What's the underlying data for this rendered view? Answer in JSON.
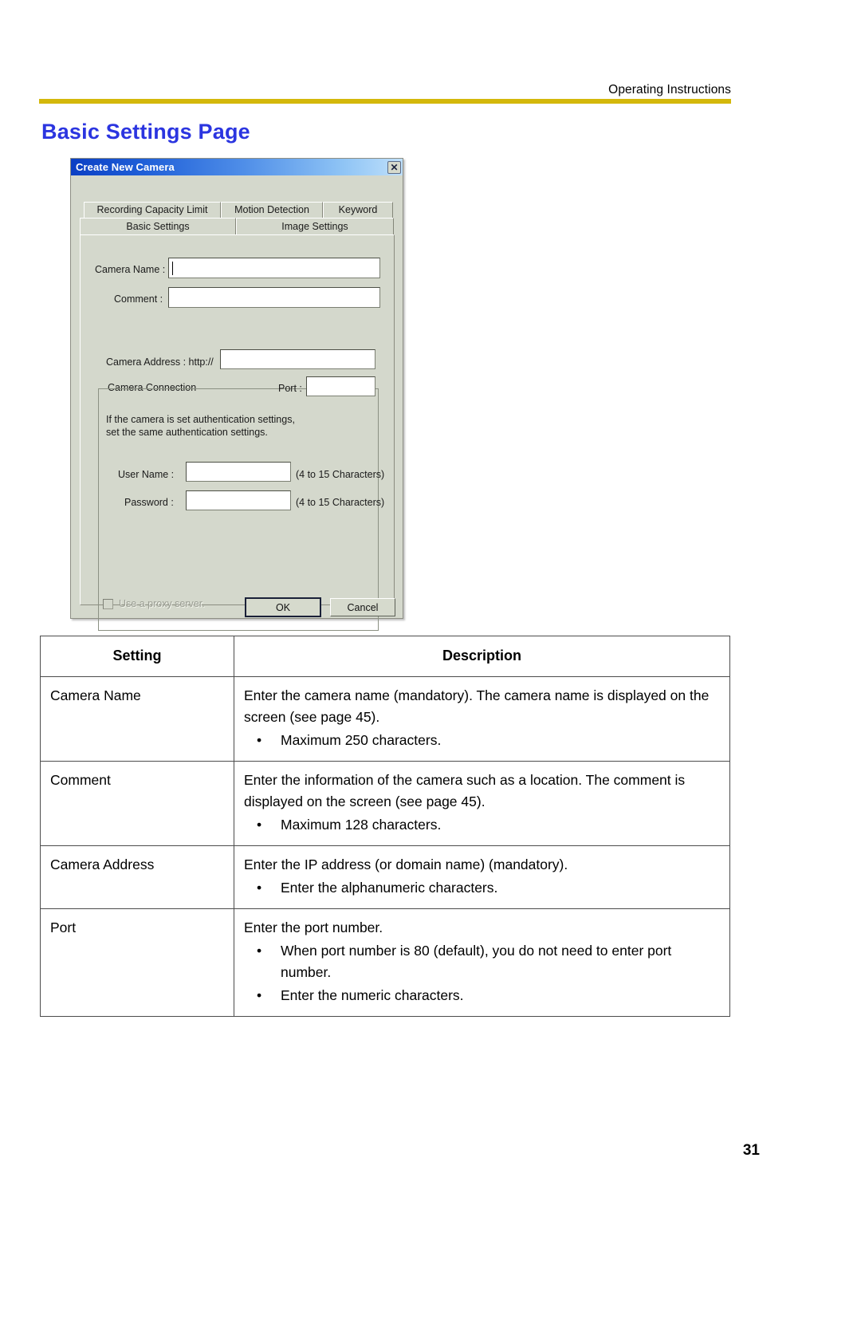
{
  "header": {
    "running_head": "Operating Instructions",
    "title": "Basic Settings Page",
    "rule_color": "#d4b80b",
    "title_color": "#2b35e0"
  },
  "dialog": {
    "title": "Create New Camera",
    "close_icon": "close-icon",
    "close_glyph": "✕",
    "tabs_top": [
      {
        "label": "Recording Capacity Limit"
      },
      {
        "label": "Motion Detection"
      },
      {
        "label": "Keyword"
      }
    ],
    "tabs_bottom": [
      {
        "label": "Basic Settings",
        "selected": true
      },
      {
        "label": "Image Settings",
        "selected": false
      }
    ],
    "fields": {
      "camera_name_label": "Camera Name :",
      "camera_name_value": "",
      "comment_label": "Comment :",
      "comment_value": ""
    },
    "group": {
      "title": "Camera Connection",
      "camera_address_label": "Camera Address : http://",
      "camera_address_value": "",
      "port_label": "Port :",
      "port_value": "",
      "auth_note": "If the camera is set authentication settings,\nset the same authentication settings.",
      "user_name_label": "User Name :",
      "user_name_value": "",
      "user_name_hint": "(4 to 15 Characters)",
      "password_label": "Password :",
      "password_value": "",
      "password_hint": "(4 to 15 Characters)",
      "proxy_checkbox_label": "Use a proxy server.",
      "proxy_checked": false,
      "proxy_disabled": true
    },
    "buttons": {
      "ok": "OK",
      "cancel": "Cancel"
    }
  },
  "table": {
    "headers": {
      "setting": "Setting",
      "description": "Description"
    },
    "rows": [
      {
        "setting": "Camera Name",
        "description": "Enter the camera name (mandatory). The camera name is displayed on the screen (see page 45).",
        "bullets": [
          {
            "marker": "•",
            "text": "Maximum 250 characters."
          }
        ]
      },
      {
        "setting": "Comment",
        "description": "Enter the information of the camera such as a location. The comment is displayed on the screen (see page 45).",
        "bullets": [
          {
            "marker": "•",
            "text": "Maximum 128 characters."
          }
        ]
      },
      {
        "setting": "Camera Address",
        "description": "Enter the IP address (or domain name) (mandatory).",
        "bullets": [
          {
            "marker": "•",
            "text": "Enter the alphanumeric characters."
          }
        ]
      },
      {
        "setting": "Port",
        "description": "Enter the port number.",
        "bullets": [
          {
            "marker": "•",
            "text": "When port number is 80 (default), you do not need to enter port number."
          },
          {
            "marker": "•",
            "text": "Enter the numeric characters."
          }
        ]
      }
    ]
  },
  "footer": {
    "page_number": "31"
  }
}
